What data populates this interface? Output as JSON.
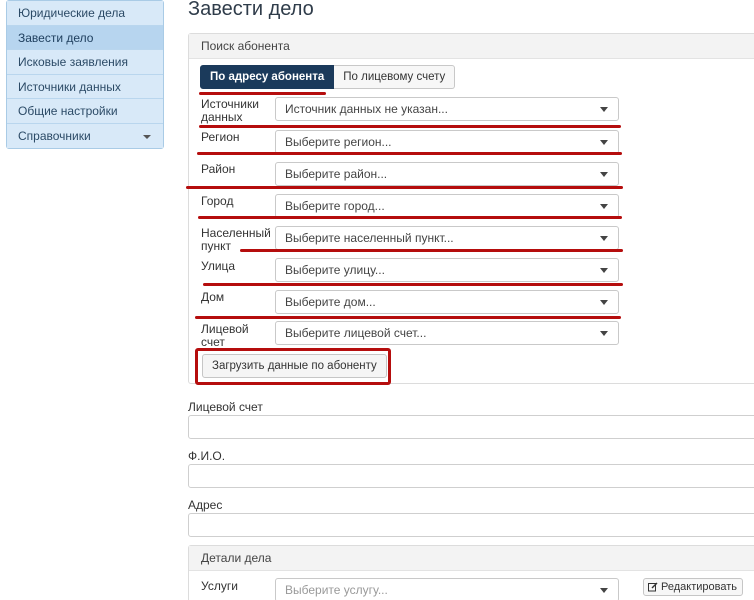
{
  "sidebar": {
    "items": [
      {
        "label": "Юридические дела"
      },
      {
        "label": "Завести дело"
      },
      {
        "label": "Исковые заявления"
      },
      {
        "label": "Источники данных"
      },
      {
        "label": "Общие настройки"
      },
      {
        "label": "Справочники"
      }
    ]
  },
  "page": {
    "title": "Завести дело"
  },
  "search_panel": {
    "heading": "Поиск абонента",
    "tabs": [
      "По адресу абонента",
      "По лицевому счету"
    ],
    "fields": [
      {
        "label": "Источники данных",
        "value": "Источник данных не указан..."
      },
      {
        "label": "Регион",
        "value": "Выберите регион..."
      },
      {
        "label": "Район",
        "value": "Выберите район..."
      },
      {
        "label": "Город",
        "value": "Выберите город..."
      },
      {
        "label": "Населенный пункт",
        "value": "Выберите населенный пункт..."
      },
      {
        "label": "Улица",
        "value": "Выберите улицу..."
      },
      {
        "label": "Дом",
        "value": "Выберите дом..."
      },
      {
        "label": "Лицевой счет",
        "value": "Выберите лицевой счет..."
      }
    ],
    "load_button": "Загрузить данные по абоненту"
  },
  "form": {
    "account_label": "Лицевой счет",
    "fio_label": "Ф.И.О.",
    "address_label": "Адрес"
  },
  "details_panel": {
    "heading": "Детали дела",
    "services_label": "Услуги",
    "services_placeholder": "Выберите услугу...",
    "edit_button": "Редактировать"
  },
  "colors": {
    "accent": "#1b3a5b",
    "annotation": "#b50d0d",
    "sidebar": "#d4e7f7"
  }
}
